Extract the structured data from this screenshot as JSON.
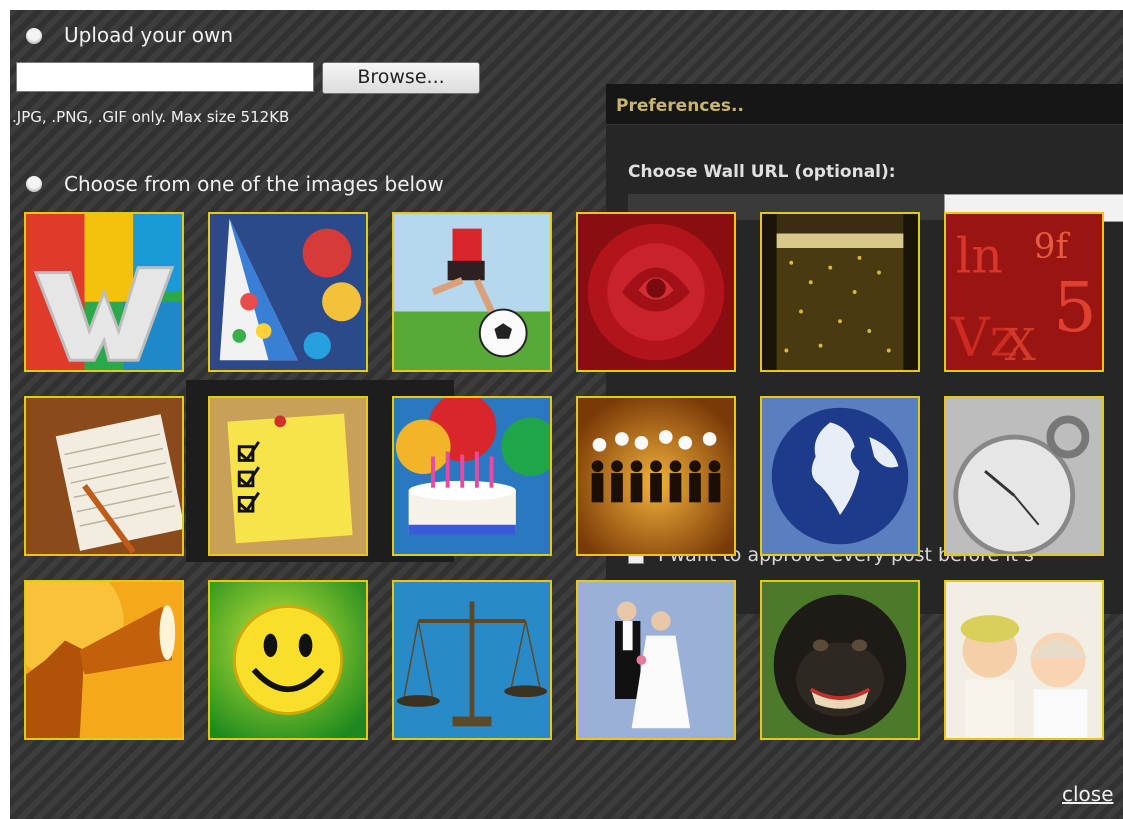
{
  "upload": {
    "option_label": "Upload your own",
    "file_value": "",
    "browse_label": "Browse...",
    "hint": ".JPG, .PNG, .GIF only. Max size 512KB"
  },
  "choose": {
    "option_label": "Choose from one of the images below"
  },
  "preferences": {
    "title": "Preferences..",
    "url_label": "Choose Wall URL (optional):",
    "approve_label": "I want to approve every post before it s"
  },
  "images": [
    {
      "name": "letter-w-image"
    },
    {
      "name": "party-hats-image"
    },
    {
      "name": "soccer-kick-image"
    },
    {
      "name": "red-rose-image"
    },
    {
      "name": "champagne-image"
    },
    {
      "name": "red-numbers-image"
    },
    {
      "name": "notepad-pencil-image"
    },
    {
      "name": "sticky-note-checklist-image"
    },
    {
      "name": "birthday-cake-image"
    },
    {
      "name": "people-thinking-image"
    },
    {
      "name": "globe-image"
    },
    {
      "name": "stopwatch-image"
    },
    {
      "name": "megaphone-image"
    },
    {
      "name": "smiley-face-image"
    },
    {
      "name": "justice-scales-image"
    },
    {
      "name": "wedding-couple-image"
    },
    {
      "name": "chimpanzee-image"
    },
    {
      "name": "babies-image"
    }
  ],
  "close_label": "close",
  "colors": {
    "thumb_border": "#e6c914",
    "accent": "#c8b46a"
  }
}
